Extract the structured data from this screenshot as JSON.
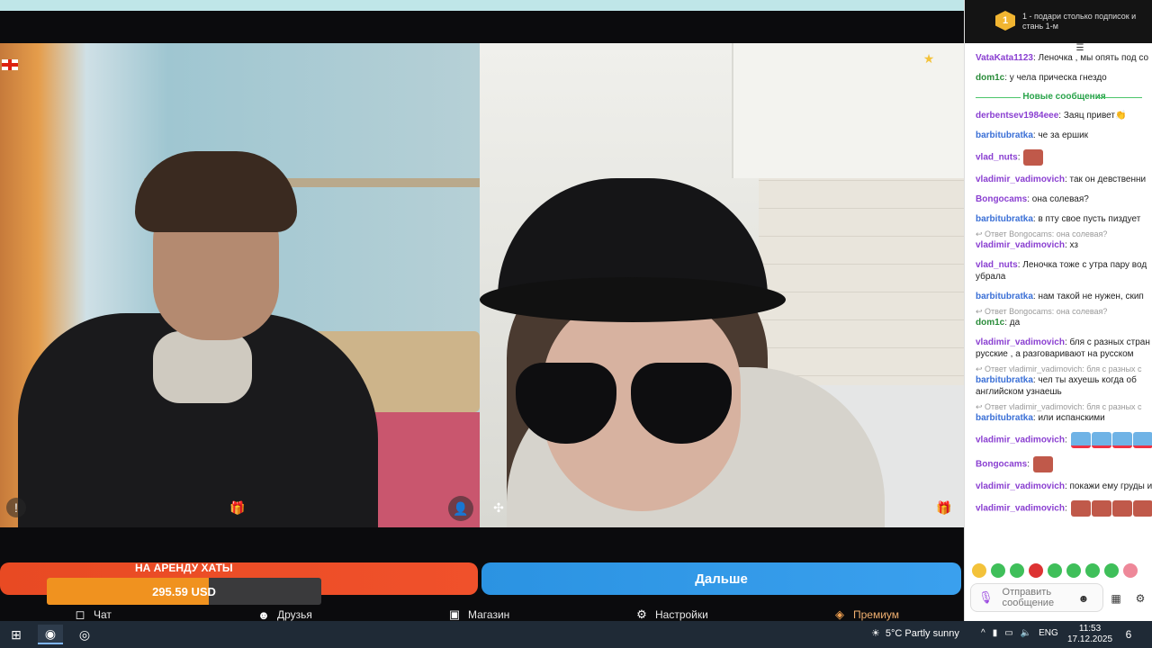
{
  "donation": {
    "title": "НА АРЕНДУ ХАТЫ",
    "amount": "295.59 USD",
    "progress_fraction": 0.59,
    "min_label": "0",
    "max_label": "500"
  },
  "next_button": {
    "label": "Дальше"
  },
  "nav": {
    "chat": "Чат",
    "friends": "Друзья",
    "shop": "Магазин",
    "settings": "Настройки",
    "premium": "Премиум"
  },
  "chat": {
    "header": {
      "rank": "1",
      "text": "1 - подари столько подписок и стань 1-м"
    },
    "new_messages_label": "Новые сообщения",
    "messages": [
      {
        "user": "VataKata1123",
        "text": "Леночка , мы опять под со"
      },
      {
        "user": "dom1c",
        "text": "у чела прическа гнездо"
      },
      {
        "user": "derbentsev1984eee",
        "text": "Заяц привет👏"
      },
      {
        "user": "barbitubratka",
        "text": "че за ершик"
      },
      {
        "user": "vlad_nuts",
        "text": ""
      },
      {
        "user": "vladimir_vadimovich",
        "text": "так он девственни"
      },
      {
        "user": "Bongocams",
        "text": "она солевая?"
      },
      {
        "user": "barbitubratka",
        "text": "в пту свое пусть пиздует"
      },
      {
        "reply": "↩ Ответ Bongocams: она солевая?",
        "user": "vladimir_vadimovich",
        "text": "хз"
      },
      {
        "user": "vlad_nuts",
        "text": "Леночка тоже с утра пару вод убрала"
      },
      {
        "user": "barbitubratka",
        "text": "нам такой не нужен, скип"
      },
      {
        "reply": "↩ Ответ Bongocams: она солевая?",
        "user": "dom1c",
        "text": "да"
      },
      {
        "user": "vladimir_vadimovich",
        "text": "бля с разных стран русские , а разговаривают на русском"
      },
      {
        "reply": "↩ Ответ vladimir_vadimovich: бля с разных с",
        "user": "barbitubratka",
        "text": "чел ты ахуешь когда об английском узнаешь"
      },
      {
        "reply": "↩ Ответ vladimir_vadimovich: бля с разных с",
        "user": "barbitubratka",
        "text": "или испанскими"
      },
      {
        "user": "vladimir_vadimovich",
        "text": ""
      },
      {
        "user": "Bongocams",
        "text": ""
      },
      {
        "user": "vladimir_vadimovich",
        "text": "покажи ему груды и попку чтоли"
      },
      {
        "user": "vladimir_vadimovich",
        "text": ""
      }
    ],
    "input_placeholder": "Отправить сообщение"
  },
  "taskbar": {
    "weather": "5°C  Partly sunny",
    "language": "ENG",
    "time": "11:53",
    "date": "17.12.2025",
    "notifications": "6"
  },
  "colors": {
    "accent_red": "#e84a23",
    "accent_blue": "#3aa0ee",
    "username_purple": "#8a3fd1",
    "username_blue": "#3a6fd6",
    "new_messages_green": "#29a34a"
  }
}
